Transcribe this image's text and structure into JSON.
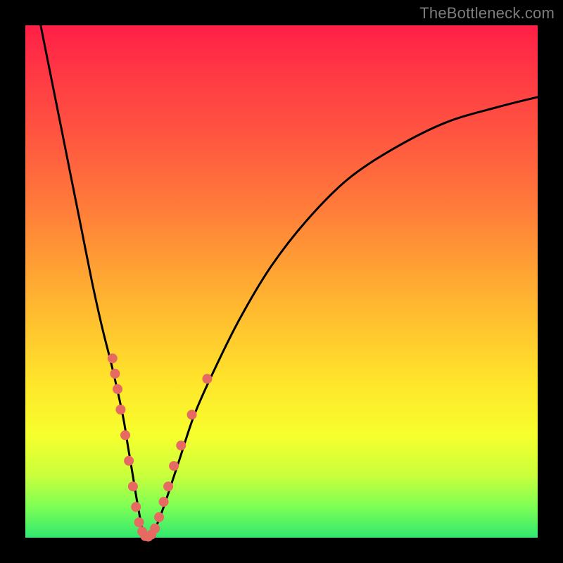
{
  "watermark": "TheBottleneck.com",
  "chart_data": {
    "type": "line",
    "title": "",
    "xlabel": "",
    "ylabel": "",
    "xlim": [
      0,
      100
    ],
    "ylim": [
      0,
      100
    ],
    "grid": false,
    "legend": false,
    "series": [
      {
        "name": "bottleneck-curve",
        "color": "#000000",
        "x": [
          3,
          5,
          7,
          9,
          11,
          13,
          15,
          17,
          19,
          20,
          21,
          22,
          23,
          24,
          25,
          27,
          30,
          33,
          37,
          42,
          48,
          55,
          63,
          72,
          82,
          92,
          100
        ],
        "y": [
          100,
          90,
          80,
          70,
          60,
          50,
          41,
          33,
          24,
          18,
          12,
          6,
          1,
          0,
          1,
          6,
          15,
          24,
          33,
          43,
          53,
          62,
          70,
          76,
          81,
          84,
          86
        ]
      }
    ],
    "markers": {
      "name": "highlight-dots",
      "color": "#e66a62",
      "radius_px": 7,
      "points": [
        {
          "x": 17.0,
          "y": 35
        },
        {
          "x": 17.5,
          "y": 32
        },
        {
          "x": 18.0,
          "y": 29
        },
        {
          "x": 18.6,
          "y": 25
        },
        {
          "x": 19.5,
          "y": 20
        },
        {
          "x": 20.2,
          "y": 15
        },
        {
          "x": 21.0,
          "y": 10
        },
        {
          "x": 21.6,
          "y": 6
        },
        {
          "x": 22.2,
          "y": 3
        },
        {
          "x": 22.8,
          "y": 1.2
        },
        {
          "x": 23.4,
          "y": 0.3
        },
        {
          "x": 24.0,
          "y": 0.2
        },
        {
          "x": 24.6,
          "y": 0.6
        },
        {
          "x": 25.3,
          "y": 1.8
        },
        {
          "x": 26.1,
          "y": 4
        },
        {
          "x": 27.0,
          "y": 7
        },
        {
          "x": 27.9,
          "y": 10
        },
        {
          "x": 29.0,
          "y": 14
        },
        {
          "x": 30.4,
          "y": 18
        },
        {
          "x": 32.5,
          "y": 24
        },
        {
          "x": 35.5,
          "y": 31
        }
      ]
    }
  }
}
